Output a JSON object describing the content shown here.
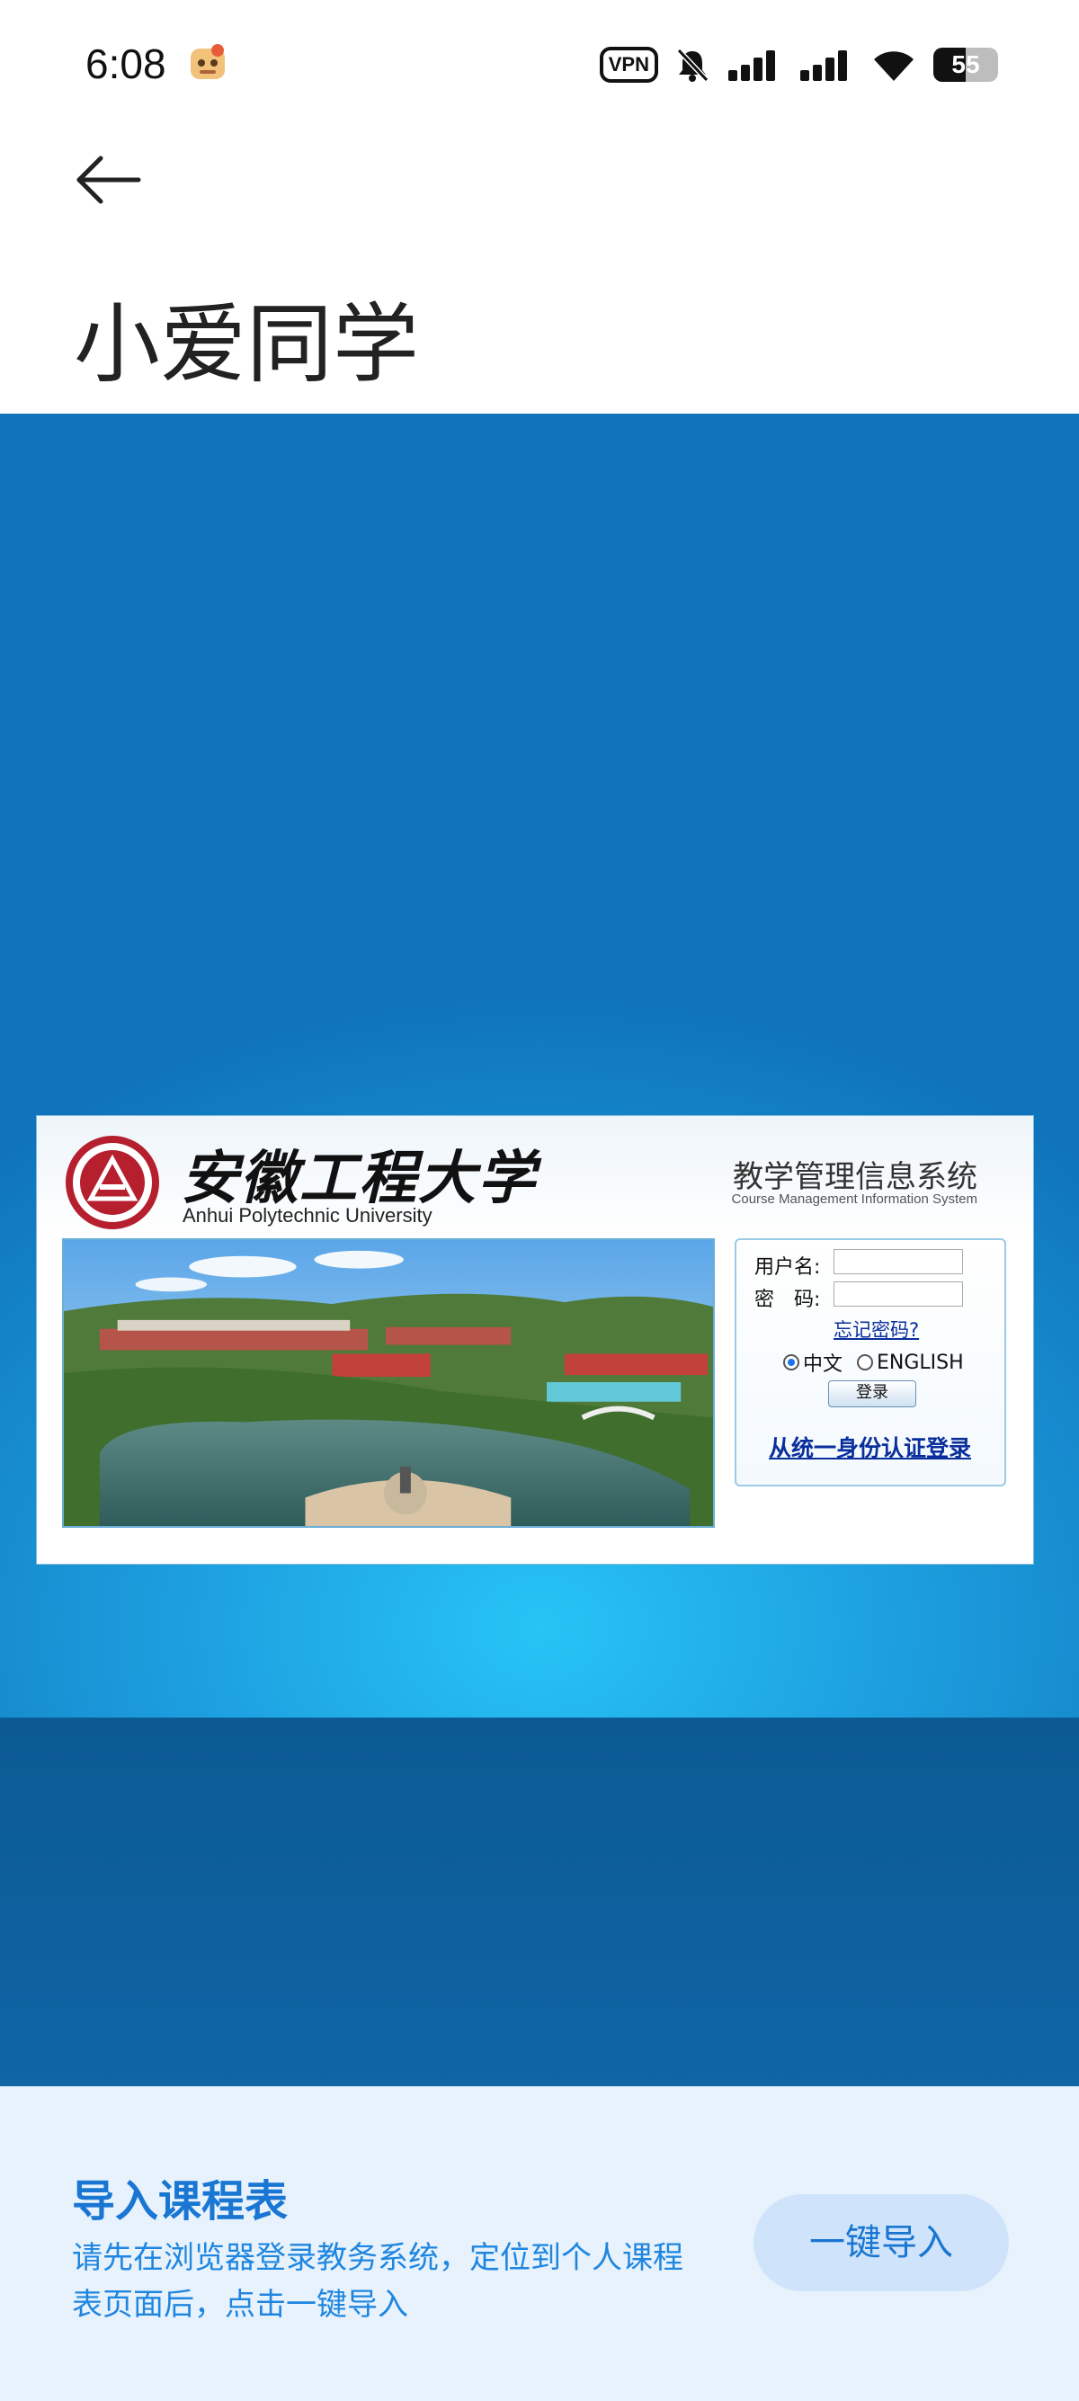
{
  "status_bar": {
    "time": "6:08",
    "vpn_label": "VPN",
    "battery_level": "55"
  },
  "app": {
    "title": "小爱同学"
  },
  "login_page": {
    "university_name_cn": "安徽工程大学",
    "university_name_en": "Anhui Polytechnic University",
    "system_name_cn": "教学管理信息系统",
    "system_name_en": "Course Management Information System",
    "username_label": "用户名:",
    "password_label": "密　码:",
    "username_value": "",
    "password_value": "",
    "forgot_password": "忘记密码?",
    "lang_options": [
      "中文",
      "ENGLISH"
    ],
    "lang_selected": "中文",
    "login_button": "登录",
    "sso_link": "从统一身份认证登录"
  },
  "import": {
    "title": "导入课程表",
    "description": "请先在浏览器登录教务系统，定位到个人课程表页面后，点击一键导入",
    "button": "一键导入"
  },
  "colors": {
    "accent": "#1976d2",
    "webview_bg": "#1ea2e1",
    "import_bg": "#e7f2fd"
  }
}
